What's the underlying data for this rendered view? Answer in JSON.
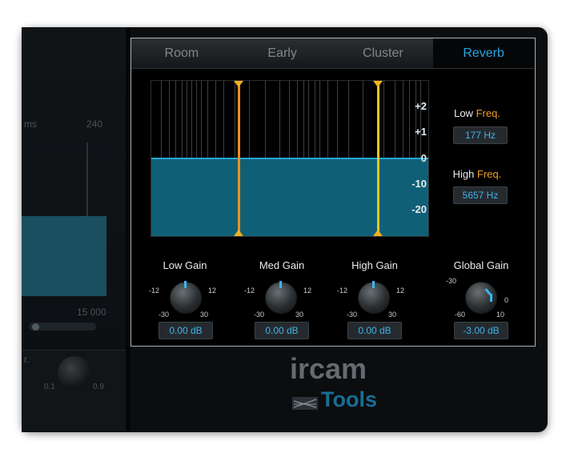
{
  "background": {
    "ms_label": "ms",
    "ms_value": "240",
    "freq_value": "15 000",
    "panel_label": "r.",
    "knob_min": "0.1",
    "knob_max": "0.9"
  },
  "tabs": [
    {
      "label": "Room",
      "active": false
    },
    {
      "label": "Early",
      "active": false
    },
    {
      "label": "Cluster",
      "active": false
    },
    {
      "label": "Reverb",
      "active": true
    }
  ],
  "graph": {
    "db_scale": [
      "+2",
      "+1",
      "0",
      "-10",
      "-20"
    ]
  },
  "freq": {
    "low_prefix": "Low ",
    "low_accent": "Freq.",
    "low_value": "177 Hz",
    "high_prefix": "High ",
    "high_accent": "Freq.",
    "high_value": "5657 Hz"
  },
  "knobs": {
    "low_gain": {
      "title": "Low Gain",
      "value": "0.00 dB",
      "t_left": "-12",
      "t_right": "12",
      "b_left": "-30",
      "b_right": "30"
    },
    "med_gain": {
      "title": "Med Gain",
      "value": "0.00 dB",
      "t_left": "-12",
      "t_right": "12",
      "b_left": "-30",
      "b_right": "30"
    },
    "high_gain": {
      "title": "High Gain",
      "value": "0.00 dB",
      "t_left": "-12",
      "t_right": "12",
      "b_left": "-30",
      "b_right": "30"
    },
    "global_gain": {
      "title": "Global Gain",
      "value": "-3.00 dB",
      "t_left": "-30",
      "t_right": "0",
      "b_left": "-60",
      "b_right": "10"
    }
  },
  "logo": {
    "brand": "ircam",
    "product": "Tools"
  },
  "colors": {
    "accent_blue": "#2aa3e0",
    "low_marker": "#f08e20",
    "high_marker": "#f2c51e",
    "band_fill": "#0f6077"
  }
}
